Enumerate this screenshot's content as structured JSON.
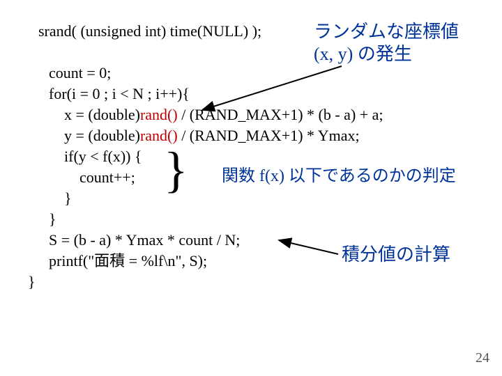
{
  "code": {
    "l1": "srand( (unsigned int) time(NULL) );",
    "l2": "count = 0;",
    "l3": "for(i = 0 ; i < N ; i++){",
    "l4a": "    x = (double)",
    "l4b": "rand()",
    "l4c": " / (RAND_MAX+1) * (b - a) + a;",
    "l5a": "    y = (double)",
    "l5b": "rand()",
    "l5c": " / (RAND_MAX+1) * Ymax;",
    "l6": "    if(y < f(x)) {",
    "l7": "        count++;",
    "l8": "    }",
    "l9": "}",
    "l10": "S = (b - a) * Ymax * count / N;",
    "l11": "printf(\"面積 = %lf\\n\", S);",
    "l12": "}"
  },
  "annotations": {
    "a1_line1": "ランダムな座標値",
    "a1_line2": "(x, y) の発生",
    "a2": "関数 f(x) 以下であるのかの判定",
    "a3": "積分値の計算"
  },
  "page_number": "24"
}
